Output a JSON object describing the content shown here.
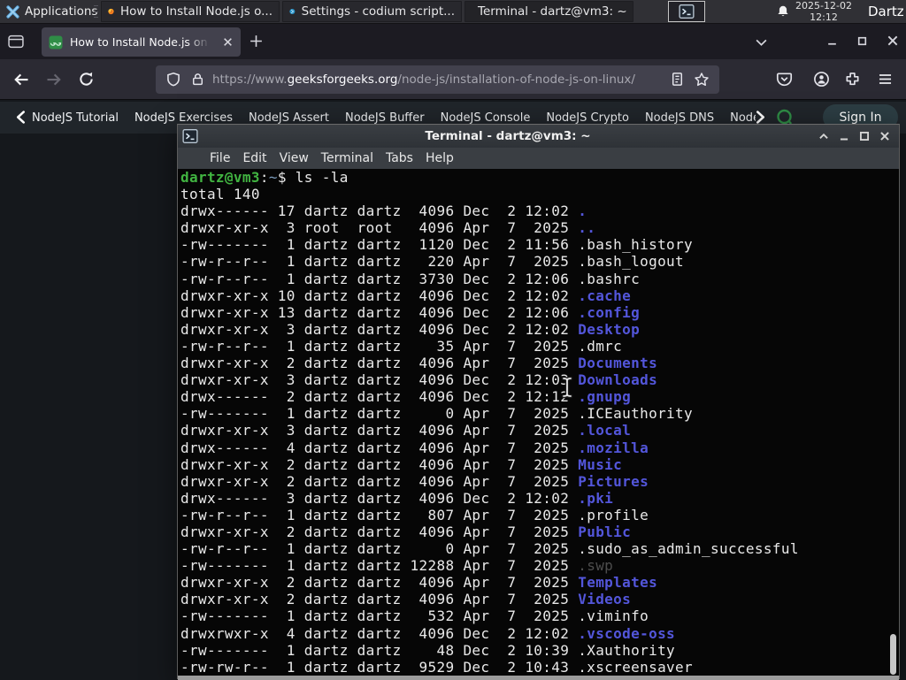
{
  "panel": {
    "applications_label": "Applications",
    "taskbar": [
      {
        "label": "How to Install Node.js o...",
        "icon": "firefox-icon"
      },
      {
        "label": "Settings - codium script...",
        "icon": "vscodium-icon"
      },
      {
        "label": "Terminal - dartz@vm3: ~",
        "icon": "terminal-icon"
      }
    ],
    "tray_launcher_icon": "terminal-icon",
    "clock_date": "2025-12-02",
    "clock_time": "12:12",
    "user": "Dartz"
  },
  "browser": {
    "tab_title": "How to Install Node.js on",
    "url_scheme": "https://www.",
    "url_domain": "geeksforgeeks.org",
    "url_path": "/node-js/installation-of-node-js-on-linux/"
  },
  "gfg_nav": {
    "items": [
      "NodeJS Tutorial",
      "NodeJS Exercises",
      "NodeJS Assert",
      "NodeJS Buffer",
      "NodeJS Console",
      "NodeJS Crypto",
      "NodeJS DNS",
      "Node"
    ],
    "sign_in": "Sign In",
    "brand_green": "#2f8d46"
  },
  "terminal": {
    "title": "Terminal - dartz@vm3: ~",
    "menu": [
      "File",
      "Edit",
      "View",
      "Terminal",
      "Tabs",
      "Help"
    ],
    "prompt": {
      "user_host": "dartz@vm3",
      "colon": ":",
      "path": "~",
      "dollar": "$ ",
      "command": "ls -la"
    },
    "colors": {
      "prompt_green": "#41b441",
      "path_blue": "#7b9cbc",
      "dir_blue": "#5356db",
      "dim_gray": "#4d4d4d",
      "text": "#e9e9e9",
      "background": "#060606"
    },
    "lines": [
      {
        "pre": "total 140",
        "name": "",
        "type": "plain"
      },
      {
        "pre": "drwx------ 17 dartz dartz  4096 Dec  2 12:02 ",
        "name": ".",
        "type": "dir"
      },
      {
        "pre": "drwxr-xr-x  3 root  root   4096 Apr  7  2025 ",
        "name": "..",
        "type": "dir"
      },
      {
        "pre": "-rw-------  1 dartz dartz  1120 Dec  2 11:56 ",
        "name": ".bash_history",
        "type": "file"
      },
      {
        "pre": "-rw-r--r--  1 dartz dartz   220 Apr  7  2025 ",
        "name": ".bash_logout",
        "type": "file"
      },
      {
        "pre": "-rw-r--r--  1 dartz dartz  3730 Dec  2 12:06 ",
        "name": ".bashrc",
        "type": "file"
      },
      {
        "pre": "drwxr-xr-x 10 dartz dartz  4096 Dec  2 12:02 ",
        "name": ".cache",
        "type": "dir"
      },
      {
        "pre": "drwxr-xr-x 13 dartz dartz  4096 Dec  2 12:06 ",
        "name": ".config",
        "type": "dir"
      },
      {
        "pre": "drwxr-xr-x  3 dartz dartz  4096 Dec  2 12:02 ",
        "name": "Desktop",
        "type": "dir"
      },
      {
        "pre": "-rw-r--r--  1 dartz dartz    35 Apr  7  2025 ",
        "name": ".dmrc",
        "type": "file"
      },
      {
        "pre": "drwxr-xr-x  2 dartz dartz  4096 Apr  7  2025 ",
        "name": "Documents",
        "type": "dir"
      },
      {
        "pre": "drwxr-xr-x  3 dartz dartz  4096 Dec  2 12:03 ",
        "name": "Downloads",
        "type": "dir"
      },
      {
        "pre": "drwx------  2 dartz dartz  4096 Dec  2 12:12 ",
        "name": ".gnupg",
        "type": "dir"
      },
      {
        "pre": "-rw-------  1 dartz dartz     0 Apr  7  2025 ",
        "name": ".ICEauthority",
        "type": "file"
      },
      {
        "pre": "drwxr-xr-x  3 dartz dartz  4096 Apr  7  2025 ",
        "name": ".local",
        "type": "dir"
      },
      {
        "pre": "drwx------  4 dartz dartz  4096 Apr  7  2025 ",
        "name": ".mozilla",
        "type": "dir"
      },
      {
        "pre": "drwxr-xr-x  2 dartz dartz  4096 Apr  7  2025 ",
        "name": "Music",
        "type": "dir"
      },
      {
        "pre": "drwxr-xr-x  2 dartz dartz  4096 Apr  7  2025 ",
        "name": "Pictures",
        "type": "dir"
      },
      {
        "pre": "drwx------  3 dartz dartz  4096 Dec  2 12:02 ",
        "name": ".pki",
        "type": "dir"
      },
      {
        "pre": "-rw-r--r--  1 dartz dartz   807 Apr  7  2025 ",
        "name": ".profile",
        "type": "file"
      },
      {
        "pre": "drwxr-xr-x  2 dartz dartz  4096 Apr  7  2025 ",
        "name": "Public",
        "type": "dir"
      },
      {
        "pre": "-rw-r--r--  1 dartz dartz     0 Apr  7  2025 ",
        "name": ".sudo_as_admin_successful",
        "type": "file"
      },
      {
        "pre": "-rw-------  1 dartz dartz 12288 Apr  7  2025 ",
        "name": ".swp",
        "type": "dim"
      },
      {
        "pre": "drwxr-xr-x  2 dartz dartz  4096 Apr  7  2025 ",
        "name": "Templates",
        "type": "dir"
      },
      {
        "pre": "drwxr-xr-x  2 dartz dartz  4096 Apr  7  2025 ",
        "name": "Videos",
        "type": "dir"
      },
      {
        "pre": "-rw-------  1 dartz dartz   532 Apr  7  2025 ",
        "name": ".viminfo",
        "type": "file"
      },
      {
        "pre": "drwxrwxr-x  4 dartz dartz  4096 Dec  2 12:02 ",
        "name": ".vscode-oss",
        "type": "dir"
      },
      {
        "pre": "-rw-------  1 dartz dartz    48 Dec  2 10:39 ",
        "name": ".Xauthority",
        "type": "file"
      },
      {
        "pre": "-rw-rw-r--  1 dartz dartz  9529 Dec  2 10:43 ",
        "name": ".xscreensaver",
        "type": "file"
      }
    ]
  }
}
